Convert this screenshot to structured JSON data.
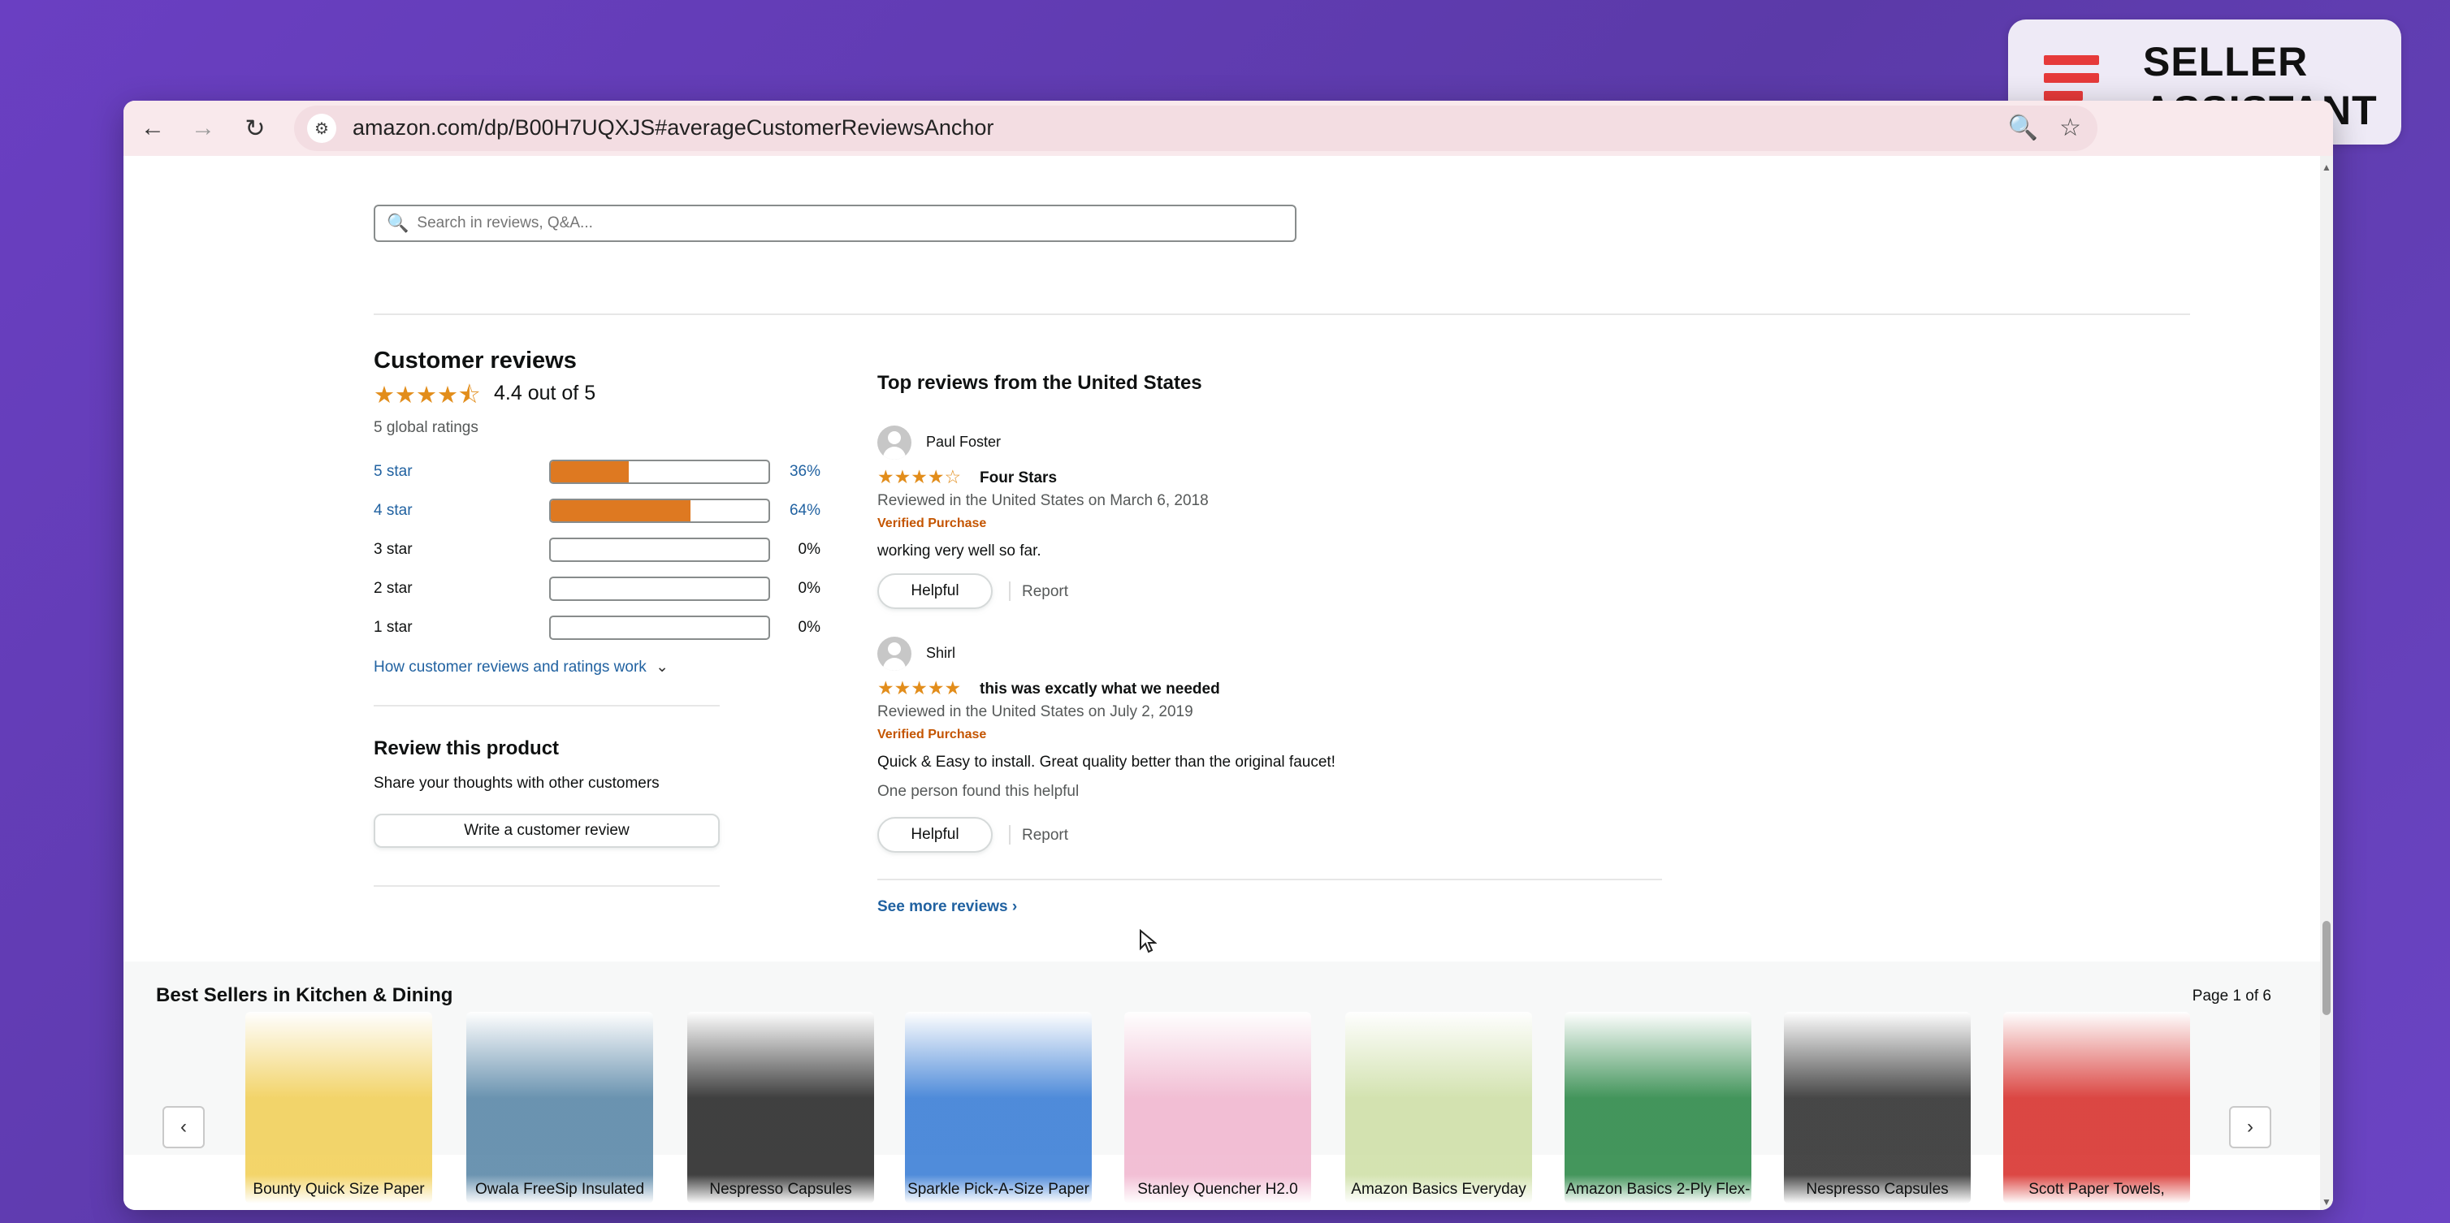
{
  "badge": {
    "line1": "SELLER",
    "line2": "ASSISTANT",
    "colors": [
      "#e63a3a",
      "#e63a3a",
      "#1a1a2e"
    ]
  },
  "browser": {
    "url": "amazon.com/dp/B00H7UQXJS#averageCustomerReviewsAnchor",
    "back_icon": "←",
    "forward_icon": "→",
    "reload_icon": "↻",
    "site_icon": "⚙",
    "zoom_icon": "🔍",
    "star_icon": "☆"
  },
  "search": {
    "placeholder": "Search in reviews, Q&A...",
    "icon": "🔍"
  },
  "customer_reviews": {
    "title": "Customer reviews",
    "stars": "★★★★⯪",
    "rating_text": "4.4 out of 5",
    "global_ratings": "5 global ratings",
    "histogram": [
      {
        "label": "5 star",
        "percent_text": "36%",
        "fraction": 0.36,
        "link": true
      },
      {
        "label": "4 star",
        "percent_text": "64%",
        "fraction": 0.64,
        "link": true
      },
      {
        "label": "3 star",
        "percent_text": "0%",
        "fraction": 0,
        "link": false
      },
      {
        "label": "2 star",
        "percent_text": "0%",
        "fraction": 0,
        "link": false
      },
      {
        "label": "1 star",
        "percent_text": "0%",
        "fraction": 0,
        "link": false
      }
    ],
    "how_it_works": "How customer reviews and ratings work",
    "chevron": "⌄"
  },
  "review_product": {
    "title": "Review this product",
    "subtitle": "Share your thoughts with other customers",
    "button": "Write a customer review"
  },
  "top_reviews": {
    "title": "Top reviews from the United States",
    "reviews": [
      {
        "author": "Paul Foster",
        "stars": "★★★★☆",
        "headline": "Four Stars",
        "meta": "Reviewed in the United States on March 6, 2018",
        "verified": "Verified Purchase",
        "body": "working very well so far.",
        "helpful_count": "",
        "helpful": "Helpful",
        "report": "Report"
      },
      {
        "author": "Shirl",
        "stars": "★★★★★",
        "headline": "this was excatly what we needed",
        "meta": "Reviewed in the United States on July 2, 2019",
        "verified": "Verified Purchase",
        "body": "Quick & Easy to install. Great quality better than the original faucet!",
        "helpful_count": "One person found this helpful",
        "helpful": "Helpful",
        "report": "Report"
      }
    ],
    "see_more": "See more reviews",
    "see_more_chevron": "›"
  },
  "best_sellers": {
    "title": "Best Sellers in Kitchen & Dining",
    "page": "Page 1 of 6",
    "prev": "‹",
    "next": "›",
    "products": [
      {
        "title": "Bounty Quick Size Paper",
        "color": "#f2d05a"
      },
      {
        "title": "Owala FreeSip Insulated",
        "color": "#5b88a8"
      },
      {
        "title": "Nespresso Capsules",
        "color": "#2b2b2b"
      },
      {
        "title": "Sparkle Pick-A-Size Paper",
        "color": "#3c7fd6"
      },
      {
        "title": "Stanley Quencher H2.0",
        "color": "#f1b8d0"
      },
      {
        "title": "Amazon Basics Everyday",
        "color": "#cfe0a8"
      },
      {
        "title": "Amazon Basics 2-Ply Flex-",
        "color": "#2f8a4a"
      },
      {
        "title": "Nespresso Capsules",
        "color": "#333333"
      },
      {
        "title": "Scott Paper Towels,",
        "color": "#d8332f"
      }
    ]
  }
}
